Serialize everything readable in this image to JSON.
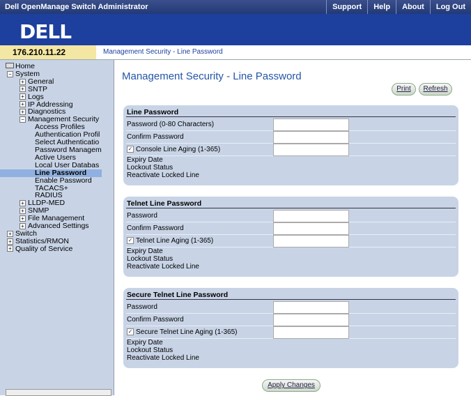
{
  "header": {
    "app_title": "Dell OpenManage Switch Administrator",
    "links": [
      "Support",
      "Help",
      "About",
      "Log Out"
    ],
    "logo": "DELL"
  },
  "ipbar": {
    "ip": "176.210.11.22",
    "breadcrumb": "Management Security - Line Password"
  },
  "sidebar": {
    "home": "Home",
    "system": "System",
    "system_items": [
      "General",
      "SNTP",
      "Logs",
      "IP Addressing",
      "Diagnostics"
    ],
    "mgmt_security": "Management Security",
    "mgmt_items": [
      "Access Profiles",
      "Authentication Profil",
      "Select Authenticatio",
      "Password Managem",
      "Active Users",
      "Local User Databas",
      "Line Password",
      "Enable Password",
      "TACACS+",
      "RADIUS"
    ],
    "system_items2": [
      "LLDP-MED",
      "SNMP",
      "File Management",
      "Advanced Settings"
    ],
    "top_items": [
      "Switch",
      "Statistics/RMON",
      "Quality of Service"
    ]
  },
  "main": {
    "title": "Management Security - Line Password",
    "print_label": "Print",
    "refresh_label": "Refresh",
    "apply_label": "Apply Changes"
  },
  "panels": [
    {
      "title": "Line Password",
      "password_label": "Password (0-80 Characters)",
      "confirm_label": "Confirm Password",
      "aging_label": "Console Line Aging (1-365)",
      "expiry_label": "Expiry Date",
      "lockout_label": "Lockout Status",
      "reactivate_label": "Reactivate Locked Line"
    },
    {
      "title": "Telnet Line Password",
      "password_label": "Password",
      "confirm_label": "Confirm Password",
      "aging_label": "Telnet Line Aging (1-365)",
      "expiry_label": "Expiry Date",
      "lockout_label": "Lockout Status",
      "reactivate_label": "Reactivate Locked Line"
    },
    {
      "title": "Secure Telnet Line Password",
      "password_label": "Password",
      "confirm_label": "Confirm Password",
      "aging_label": "Secure Telnet Line Aging (1-365)",
      "expiry_label": "Expiry Date",
      "lockout_label": "Lockout Status",
      "reactivate_label": "Reactivate Locked Line"
    }
  ]
}
